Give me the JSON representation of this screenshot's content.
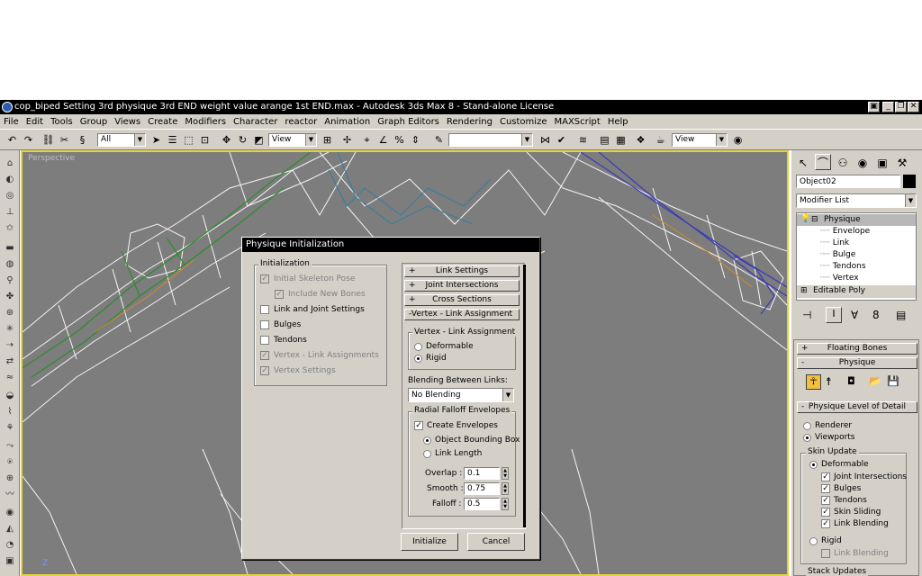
{
  "window": {
    "title": "cop_biped Setting 3rd physique 3rd END weight value arange 1st END.max - Autodesk 3ds Max 8  - Stand-alone License"
  },
  "menu": [
    "File",
    "Edit",
    "Tools",
    "Group",
    "Views",
    "Create",
    "Modifiers",
    "Character",
    "reactor",
    "Animation",
    "Graph Editors",
    "Rendering",
    "Customize",
    "MAXScript",
    "Help"
  ],
  "toolbar": {
    "selection_filter": "All",
    "ref_coord": "View",
    "named_sel": "",
    "render_view": "View"
  },
  "viewport": {
    "label": "Perspective",
    "axis": "Z"
  },
  "panel": {
    "object_name": "Object02",
    "modifier_list": "Modifier List",
    "stack": [
      "Physique",
      "Envelope",
      "Link",
      "Bulge",
      "Tendons",
      "Vertex",
      "Editable Poly"
    ],
    "rollouts": {
      "floating": "Floating Bones",
      "physique": "Physique",
      "lod": "Physique Level of Detail"
    },
    "lod": {
      "renderer": "Renderer",
      "viewports": "Viewports",
      "skin_update": "Skin Update",
      "deformable": "Deformable",
      "joint": "Joint Intersections",
      "bulges": "Bulges",
      "tendons": "Tendons",
      "skin_sliding": "Skin Sliding",
      "link_blending": "Link Blending",
      "rigid": "Rigid",
      "link_blending2": "Link Blending",
      "stack_updates": "Stack Updates"
    }
  },
  "dialog": {
    "title": "Physique Initialization",
    "init_group": "Initialization",
    "init_items": [
      {
        "label": "Initial Skeleton Pose",
        "checked": true,
        "disabled": true
      },
      {
        "label": "Include New Bones",
        "checked": true,
        "disabled": true
      },
      {
        "label": "Link and Joint Settings",
        "checked": false,
        "disabled": false
      },
      {
        "label": "Bulges",
        "checked": false,
        "disabled": false
      },
      {
        "label": "Tendons",
        "checked": false,
        "disabled": false
      },
      {
        "label": "Vertex - Link Assignments",
        "checked": true,
        "disabled": true
      },
      {
        "label": "Vertex Settings",
        "checked": true,
        "disabled": true
      }
    ],
    "rollouts": [
      "Link Settings",
      "Joint Intersections",
      "Cross Sections",
      "Vertex - Link Assignment"
    ],
    "vla_group": "Vertex - Link Assignment",
    "deformable": "Deformable",
    "rigid": "Rigid",
    "blending_label": "Blending Between Links:",
    "blending_value": "No Blending",
    "radial_group": "Radial Falloff Envelopes",
    "create_envelopes": "Create Envelopes",
    "obb": "Object Bounding Box",
    "link_length": "Link Length",
    "overlap": {
      "label": "Overlap :",
      "value": "0.1"
    },
    "smooth": {
      "label": "Smooth :",
      "value": "0.75"
    },
    "falloff": {
      "label": "Falloff :",
      "value": "0.5"
    },
    "initialize": "Initialize",
    "cancel": "Cancel"
  }
}
